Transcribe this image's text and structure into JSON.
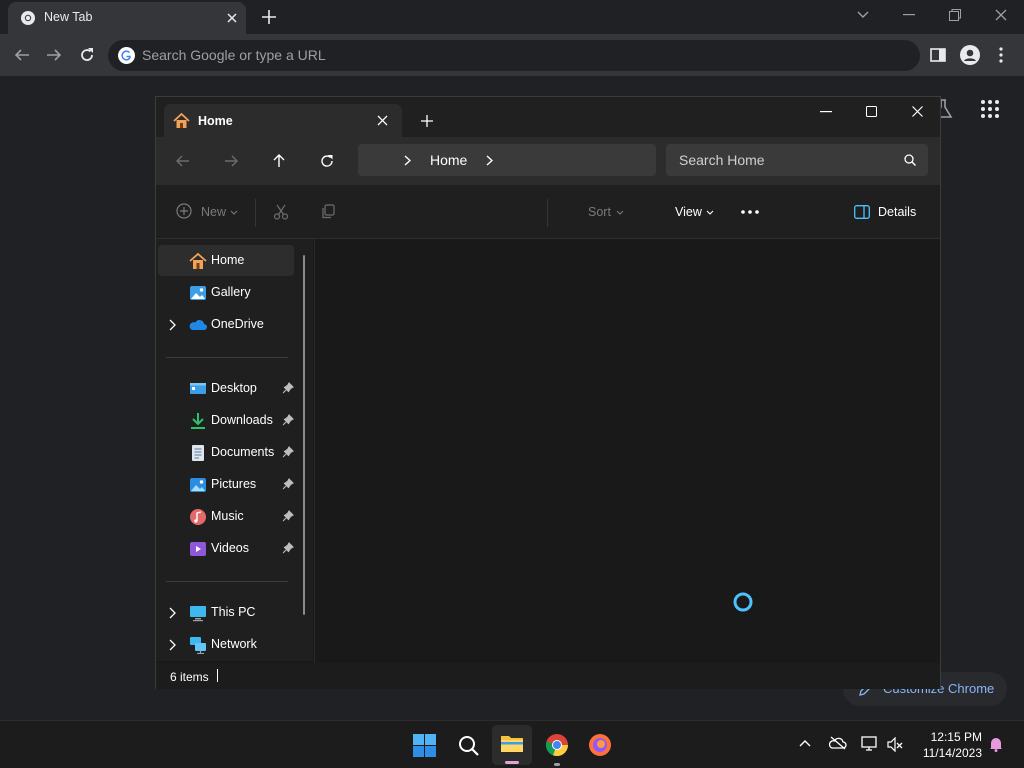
{
  "colors": {
    "accent": "#4cc2ff",
    "folder": "#f8c33c",
    "home_orange": "#f2a35a",
    "chrome_link": "#8ab4f8"
  },
  "chrome": {
    "tab_title": "New Tab",
    "omnibox_placeholder": "Search Google or type a URL",
    "customize_label": "Customize Chrome"
  },
  "explorer": {
    "tab_title": "Home",
    "breadcrumb": "Home",
    "search_placeholder": "Search Home",
    "commands": {
      "new_label": "New",
      "sort_label": "Sort",
      "view_label": "View",
      "details_label": "Details"
    },
    "sidebar": {
      "home": "Home",
      "gallery": "Gallery",
      "onedrive": "OneDrive",
      "desktop": "Desktop",
      "downloads": "Downloads",
      "documents": "Documents",
      "pictures": "Pictures",
      "music": "Music",
      "videos": "Videos",
      "this_pc": "This PC",
      "network": "Network"
    },
    "status": "6 items"
  },
  "taskbar": {
    "time": "12:15 PM",
    "date": "11/14/2023"
  }
}
